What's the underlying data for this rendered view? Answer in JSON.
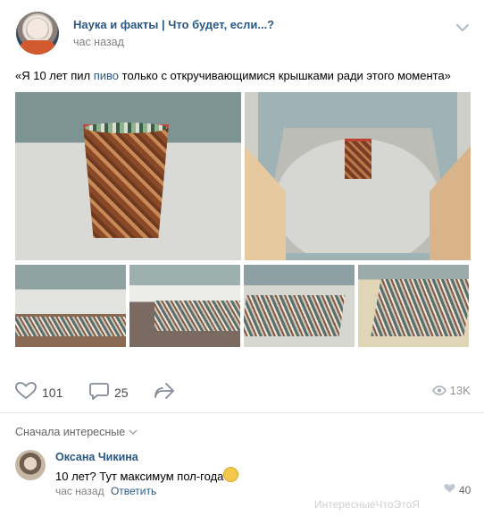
{
  "post": {
    "group_name": "Наука и факты | Что будет, если...?",
    "time": "час назад",
    "text_before": "«Я 10 лет пил ",
    "text_link": "пиво",
    "text_after": " только с откручивающимися крышками ради этого момента»"
  },
  "actions": {
    "likes": "101",
    "comments": "25",
    "views": "13K"
  },
  "comments": {
    "sort_label": "Сначала интересные",
    "items": [
      {
        "name": "Оксана Чикина",
        "text": "10 лет? Тут максимум пол-года",
        "time": "час назад",
        "reply_label": "Ответить",
        "likes": "40"
      }
    ]
  },
  "watermark": "ИнтересныеЧтоЭтоЯ"
}
